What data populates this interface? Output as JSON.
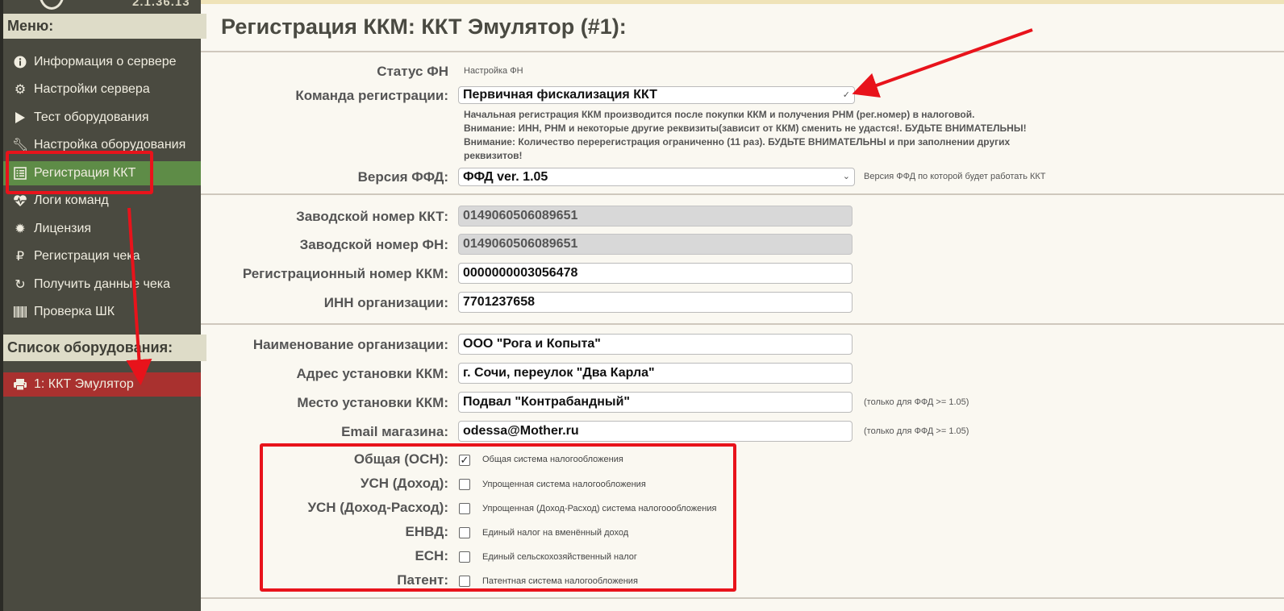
{
  "sidebar": {
    "version": "2.1.36.13",
    "menu_title": "Меню:",
    "items": [
      {
        "label": "Информация о сервере",
        "icon": "info-circle-icon"
      },
      {
        "label": "Настройки сервера",
        "icon": "gears-icon"
      },
      {
        "label": "Тест оборудования",
        "icon": "play-icon"
      },
      {
        "label": "Настройка оборудования",
        "icon": "wrench-icon"
      },
      {
        "label": "Регистрация ККТ",
        "icon": "list-alt-icon"
      },
      {
        "label": "Логи команд",
        "icon": "heartbeat-icon"
      },
      {
        "label": "Лицензия",
        "icon": "certificate-icon"
      },
      {
        "label": "Регистрация чека",
        "icon": "ruble-icon"
      },
      {
        "label": "Получить данные чека",
        "icon": "refresh-icon"
      },
      {
        "label": "Проверка ШК",
        "icon": "barcode-icon"
      }
    ],
    "devices_title": "Список оборудования:",
    "devices": [
      {
        "label": "1: ККТ Эмулятор",
        "icon": "printer-icon"
      }
    ],
    "active_color": "#5e8c47",
    "device_color": "#a9312f"
  },
  "main": {
    "title": "Регистрация ККМ: ККТ Эмулятор (#1):",
    "fn_status": {
      "label": "Статус ФН",
      "value": "Настройка ФН"
    },
    "reg_command": {
      "label": "Команда регистрации:",
      "value": "Первичная фискализация ККТ"
    },
    "notes": [
      "Начальная регистрация ККМ производится после покупки ККМ и получения РНМ (рег.номер) в налоговой.",
      "Внимание: ИНН, РНМ и некоторые другие реквизиты(зависит от ККМ) сменить не удастся!. БУДЬТЕ ВНИМАТЕЛЬНЫ!",
      "Внимание: Количество перерегистрация ограниченно (11 раз). БУДЬТЕ ВНИМАТЕЛЬНЫ и при заполнении других реквизитов!"
    ],
    "ffd": {
      "label": "Версия ФФД:",
      "value": "ФФД ver. 1.05",
      "hint": "Версия ФФД по которой будет работать ККТ"
    },
    "kkt_serial": {
      "label": "Заводской номер ККТ:",
      "value": "0149060506089651"
    },
    "fn_serial": {
      "label": "Заводской номер ФН:",
      "value": "0149060506089651"
    },
    "reg_number": {
      "label": "Регистрационный номер ККМ:",
      "value": "0000000003056478"
    },
    "inn": {
      "label": "ИНН организации:",
      "value": "7701237658"
    },
    "org_name": {
      "label": "Наименование организации:",
      "value": "ООО \"Рога и Копыта\""
    },
    "address": {
      "label": "Адрес установки ККМ:",
      "value": "г. Сочи, переулок \"Два Карла\""
    },
    "place": {
      "label": "Место установки ККМ:",
      "value": "Подвал \"Контрабандный\"",
      "hint": "(только для ФФД >= 1.05)"
    },
    "email": {
      "label": "Email магазина:",
      "value": "odessa@Mother.ru",
      "hint": "(только для ФФД >= 1.05)"
    },
    "taxes": [
      {
        "label": "Общая (ОСН):",
        "desc": "Общая система налогообложения",
        "checked": true
      },
      {
        "label": "УСН (Доход):",
        "desc": "Упрощенная система налогообложения",
        "checked": false
      },
      {
        "label": "УСН (Доход-Расход):",
        "desc": "Упрощенная (Доход-Расход) система налогоообложения",
        "checked": false
      },
      {
        "label": "ЕНВД:",
        "desc": "Единый налог на вменённый доход",
        "checked": false
      },
      {
        "label": "ЕСН:",
        "desc": "Единый сельскохозяйственный налог",
        "checked": false
      },
      {
        "label": "Патент:",
        "desc": "Патентная система налогообложения",
        "checked": false
      }
    ],
    "check_mark": "✓",
    "annotation_color": "#e8131b"
  }
}
